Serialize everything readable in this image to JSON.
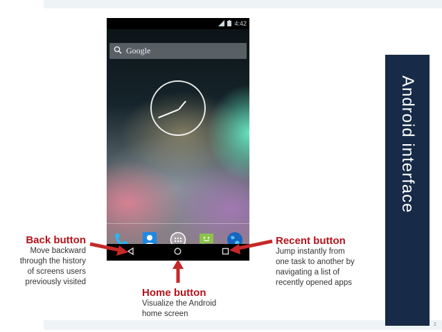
{
  "slide": {
    "side_title": "Android interface",
    "page_number": "2"
  },
  "phone": {
    "status_time": "4:42",
    "search_placeholder": "Google",
    "dock_icons": [
      "phone-icon",
      "contacts-icon",
      "app-drawer-icon",
      "messaging-icon",
      "browser-icon"
    ],
    "nav_buttons": [
      "back-icon",
      "home-icon",
      "recent-apps-icon"
    ]
  },
  "annotations": {
    "back": {
      "title": "Back button",
      "lines": [
        "Move backward",
        "through the history",
        "of screens users",
        "previously visited"
      ]
    },
    "recent": {
      "title": "Recent button",
      "lines": [
        "Jump instantly from",
        "one task to another by",
        "navigating a list of",
        "recently opened apps"
      ]
    },
    "home": {
      "title": "Home button",
      "lines": [
        "Visualize the Android",
        "home screen"
      ]
    }
  },
  "colors": {
    "accent_red": "#b5121b",
    "panel_navy": "#172a47"
  }
}
